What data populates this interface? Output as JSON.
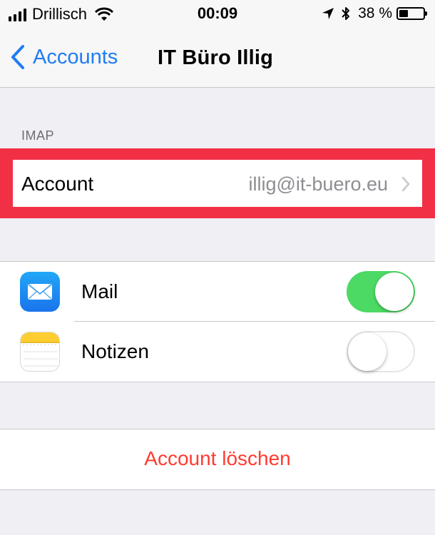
{
  "status_bar": {
    "carrier": "Drillisch",
    "time": "00:09",
    "battery_percent": "38 %",
    "battery_level": 0.38,
    "icons": [
      "signal-bars-icon",
      "wifi-icon",
      "location-arrow-icon",
      "bluetooth-icon",
      "battery-icon"
    ]
  },
  "nav": {
    "back_label": "Accounts",
    "title": "IT Büro Illig"
  },
  "imap_section": {
    "header": "IMAP",
    "account_label": "Account",
    "account_value": "illig@it-buero.eu",
    "highlight_color": "#f23045"
  },
  "services": {
    "items": [
      {
        "label": "Mail",
        "icon": "mail-app-icon",
        "enabled": true
      },
      {
        "label": "Notizen",
        "icon": "notes-app-icon",
        "enabled": false
      }
    ]
  },
  "delete": {
    "label": "Account löschen",
    "color": "#ff3b30"
  },
  "colors": {
    "accent": "#1f7cf6",
    "toggle_on": "#4cd964",
    "background": "#efeff4"
  }
}
